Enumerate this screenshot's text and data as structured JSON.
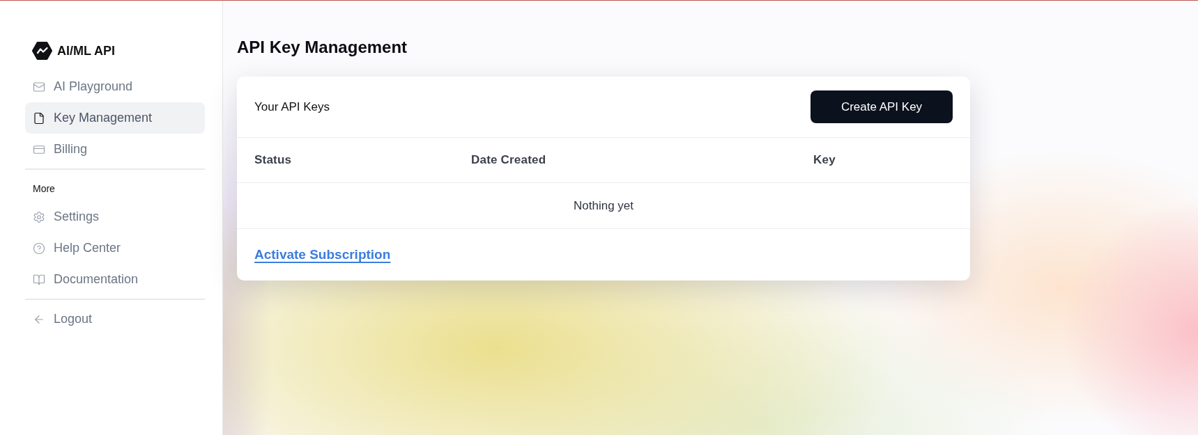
{
  "sidebar": {
    "brand": "AI/ML API",
    "groups": [
      {
        "items": [
          {
            "label": "AI Playground",
            "selected": false
          },
          {
            "label": "Key Management",
            "selected": true
          },
          {
            "label": "Billing",
            "selected": false
          }
        ]
      },
      {
        "title": "More",
        "items": [
          {
            "label": "Settings",
            "selected": false
          },
          {
            "label": "Help Center",
            "selected": false
          },
          {
            "label": "Documentation",
            "selected": false
          }
        ]
      },
      {
        "items": [
          {
            "label": "Logout",
            "selected": false
          }
        ]
      }
    ]
  },
  "page": {
    "title": "API Key Management"
  },
  "card": {
    "title": "Your API Keys",
    "button": "Create API Key",
    "table": {
      "columns": [
        "Status",
        "Date Created",
        "Key"
      ],
      "empty_text": "Nothing yet"
    },
    "link": "Activate Subscription"
  }
}
